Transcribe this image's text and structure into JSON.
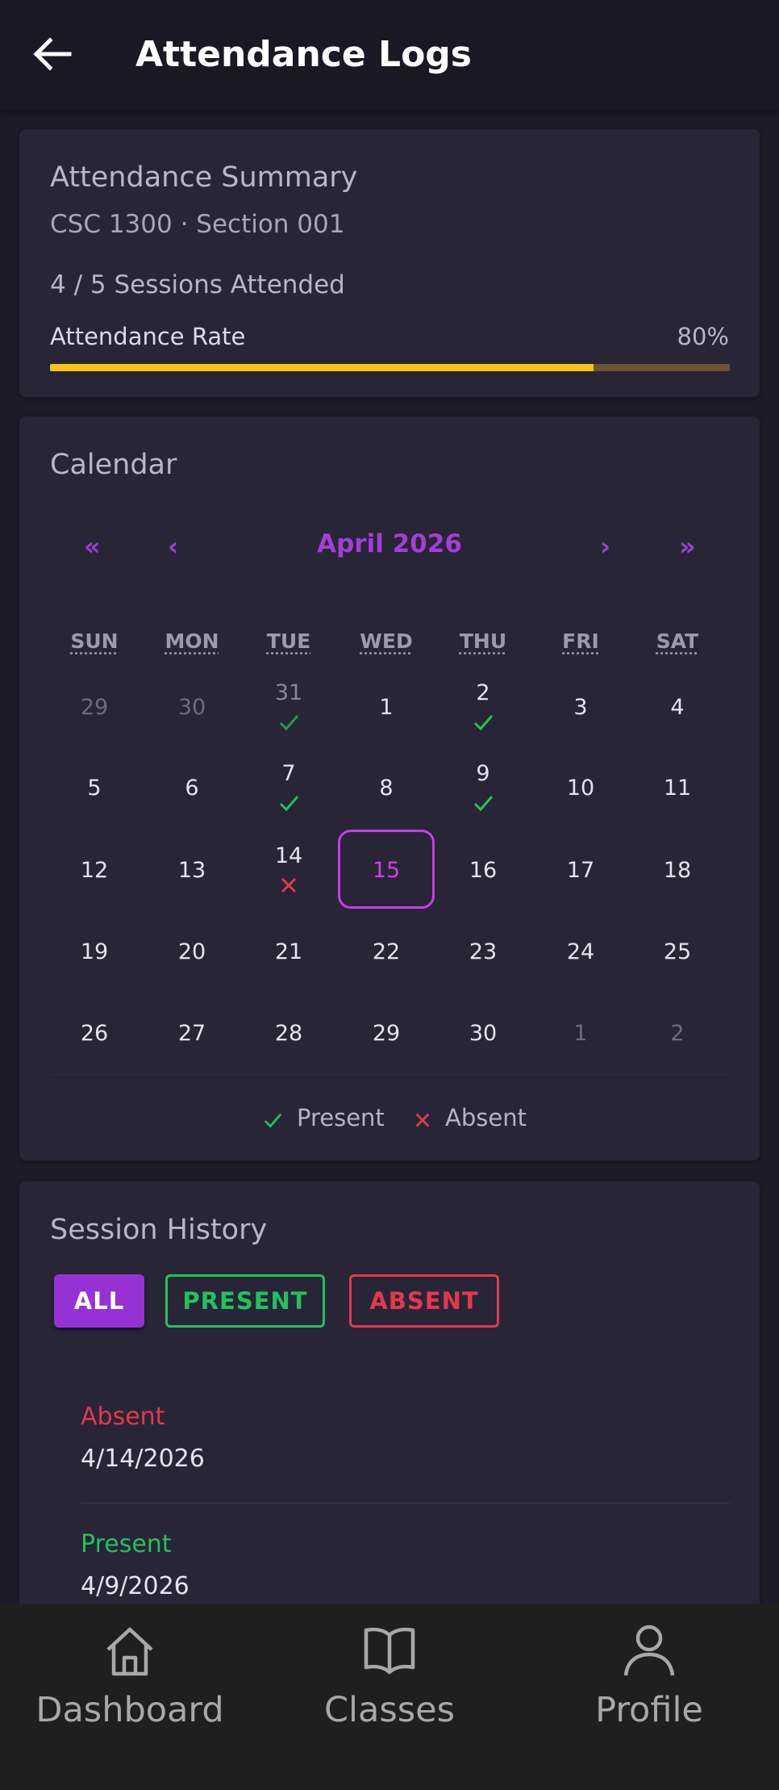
{
  "appbar": {
    "title": "Attendance Logs",
    "back_icon": "arrow-left-icon"
  },
  "summary": {
    "title": "Attendance Summary",
    "course": "CSC 1300 · Section 001",
    "sessions": "4 / 5 Sessions Attended",
    "rate_label": "Attendance Rate",
    "rate_value": "80%",
    "rate_fraction": 0.8,
    "colors": {
      "fill": "#f5c518",
      "track": "#6b5634"
    }
  },
  "calendar": {
    "title": "Calendar",
    "nav": {
      "prev_year": "«",
      "prev_month": "‹",
      "next_month": "›",
      "next_year": "»"
    },
    "month_label": "April 2026",
    "weekdays": [
      "SUN",
      "MON",
      "TUE",
      "WED",
      "THU",
      "FRI",
      "SAT"
    ],
    "weeks": [
      [
        {
          "d": "29",
          "m": true
        },
        {
          "d": "30",
          "m": true
        },
        {
          "d": "31",
          "f": true,
          "s": "present"
        },
        {
          "d": "1"
        },
        {
          "d": "2",
          "s": "present"
        },
        {
          "d": "3"
        },
        {
          "d": "4"
        }
      ],
      [
        {
          "d": "5"
        },
        {
          "d": "6"
        },
        {
          "d": "7",
          "s": "present"
        },
        {
          "d": "8"
        },
        {
          "d": "9",
          "s": "present"
        },
        {
          "d": "10"
        },
        {
          "d": "11"
        }
      ],
      [
        {
          "d": "12"
        },
        {
          "d": "13"
        },
        {
          "d": "14",
          "s": "absent"
        },
        {
          "d": "15",
          "today": true
        },
        {
          "d": "16"
        },
        {
          "d": "17"
        },
        {
          "d": "18"
        }
      ],
      [
        {
          "d": "19"
        },
        {
          "d": "20"
        },
        {
          "d": "21"
        },
        {
          "d": "22"
        },
        {
          "d": "23"
        },
        {
          "d": "24"
        },
        {
          "d": "25"
        }
      ],
      [
        {
          "d": "26"
        },
        {
          "d": "27"
        },
        {
          "d": "28"
        },
        {
          "d": "29"
        },
        {
          "d": "30"
        },
        {
          "d": "1",
          "m": true
        },
        {
          "d": "2",
          "m": true
        }
      ]
    ],
    "legend": {
      "present": "Present",
      "absent": "Absent"
    },
    "colors": {
      "accent": "#a33ed6",
      "today": "#c540e6",
      "present": "#22c15e",
      "absent": "#e2394d"
    }
  },
  "history": {
    "title": "Session History",
    "filters": {
      "all": "ALL",
      "present": "PRESENT",
      "absent": "ABSENT"
    },
    "entries": [
      {
        "status": "Absent",
        "date": "4/14/2026",
        "color": "#e2394d"
      },
      {
        "status": "Present",
        "date": "4/9/2026",
        "color": "#22c15e"
      }
    ]
  },
  "bottom_nav": {
    "items": [
      {
        "label": "Dashboard",
        "icon": "home-icon"
      },
      {
        "label": "Classes",
        "icon": "book-icon"
      },
      {
        "label": "Profile",
        "icon": "person-icon"
      }
    ]
  }
}
